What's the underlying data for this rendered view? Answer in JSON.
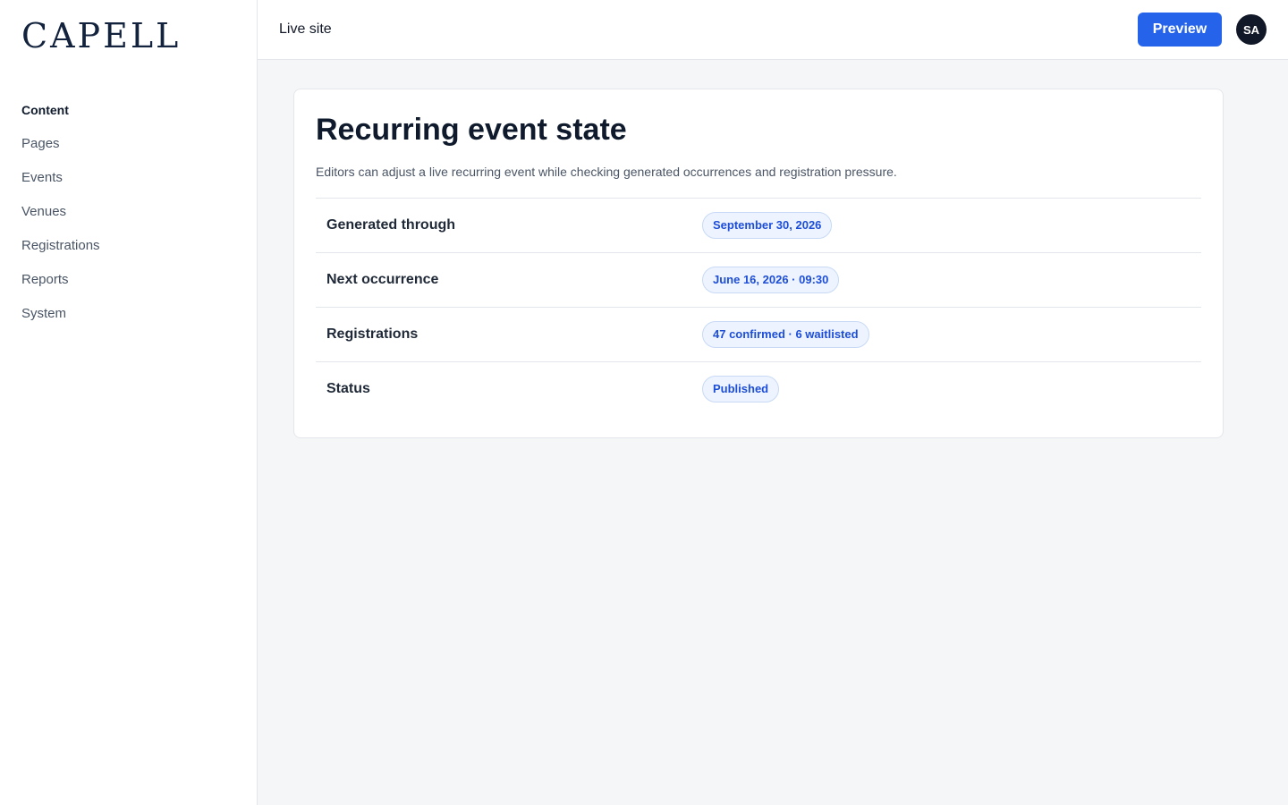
{
  "brand": {
    "logo_text": "CAPELL"
  },
  "sidebar": {
    "heading": "Content",
    "items": [
      {
        "label": "Pages"
      },
      {
        "label": "Events"
      },
      {
        "label": "Venues"
      },
      {
        "label": "Registrations"
      },
      {
        "label": "Reports"
      },
      {
        "label": "System"
      }
    ]
  },
  "topbar": {
    "live_site_label": "Live site",
    "preview_label": "Preview",
    "avatar_initials": "SA",
    "preview_color": "#2563eb"
  },
  "main": {
    "title": "Recurring event state",
    "description": "Editors can adjust a live recurring event while checking generated occurrences and registration pressure.",
    "rows": [
      {
        "label": "Generated through",
        "value": "September 30, 2026"
      },
      {
        "label": "Next occurrence",
        "value": "June 16, 2026 · 09:30"
      },
      {
        "label": "Registrations",
        "value": "47 confirmed · 6 waitlisted"
      },
      {
        "label": "Status",
        "value": "Published"
      }
    ]
  }
}
